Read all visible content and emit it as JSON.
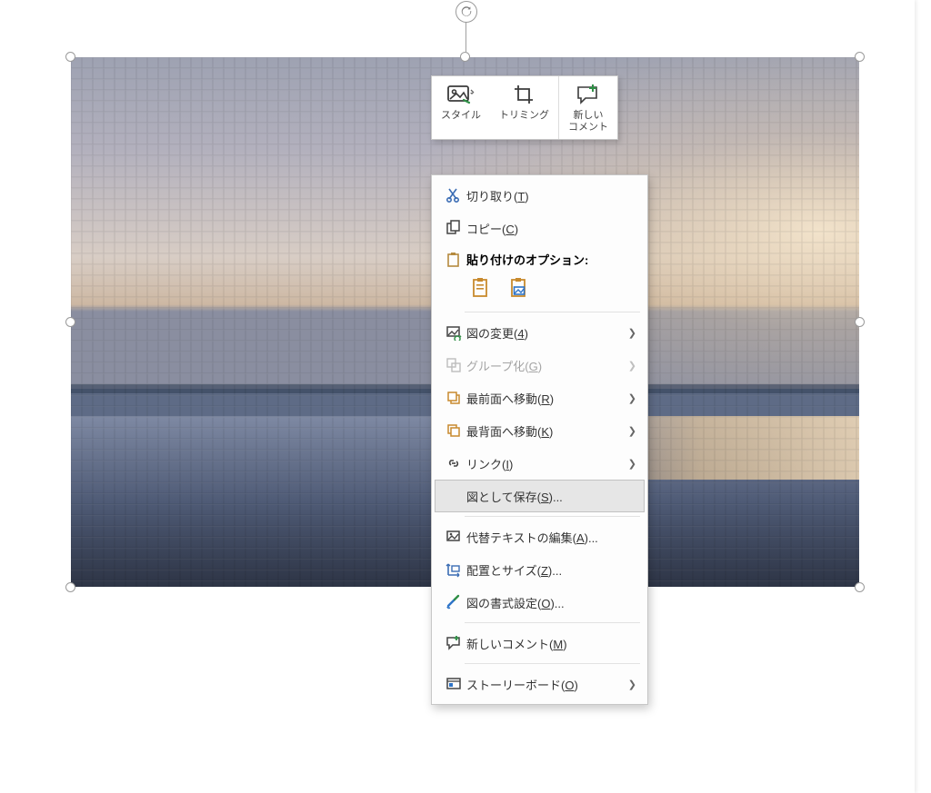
{
  "mini_toolbar": {
    "style": "スタイル",
    "crop": "トリミング",
    "comment": "新しい\nコメント"
  },
  "context_menu": {
    "cut_pre": "切り取り(",
    "cut_key": "T",
    "tail": ")",
    "copy_pre": "コピー(",
    "copy_key": "C",
    "paste_title": "貼り付けのオプション:",
    "change_pre": "図の変更(",
    "change_key": "4",
    "group_pre": "グループ化(",
    "group_key": "G",
    "front_pre": "最前面へ移動(",
    "front_key": "R",
    "back_pre": "最背面へ移動(",
    "back_key": "K",
    "link_pre": "リンク(",
    "link_key": "I",
    "save_pre": "図として保存(",
    "save_key": "S",
    "save_tail": ")...",
    "alt_pre": "代替テキストの編集(",
    "alt_key": "A",
    "alt_tail": ")...",
    "size_pre": "配置とサイズ(",
    "size_key": "Z",
    "size_tail": ")...",
    "fmt_pre": "図の書式設定(",
    "fmt_key": "O",
    "fmt_tail": ")...",
    "cmt_pre": "新しいコメント(",
    "cmt_key": "M",
    "story_pre": "ストーリーボード(",
    "story_key": "O"
  }
}
